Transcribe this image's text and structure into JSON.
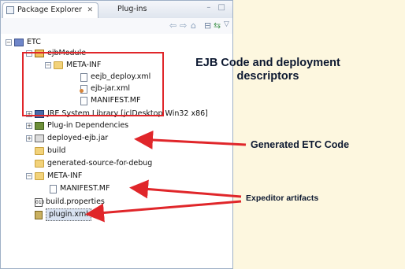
{
  "tabs": {
    "active": "Package Explorer",
    "active_close": "✕",
    "inactive": "Plug-ins"
  },
  "window_buttons": "– □",
  "toolbar": {
    "back": "⇦",
    "forward": "⇨",
    "home": "⌂",
    "collapse": "⊟",
    "link": "⇆",
    "menu": "▽"
  },
  "tree": {
    "root": "ETC",
    "ejbModule": "ejbModule",
    "meta_inf_1": "META-INF",
    "eejb_deploy": "eejb_deploy.xml",
    "ejb_jar": "ejb-jar.xml",
    "manifest_1": "MANIFEST.MF",
    "jre": "JRE System Library [jclDesktop Win32 x86]",
    "plugin_deps": "Plug-in Dependencies",
    "deployed_jar": "deployed-ejb.jar",
    "build": "build",
    "generated_source": "generated-source-for-debug",
    "meta_inf_2": "META-INF",
    "manifest_2": "MANIFEST.MF",
    "build_properties": "build.properties",
    "plugin_xml": "plugin.xml"
  },
  "annotations": {
    "ejb_line1": "EJB Code and deployment",
    "ejb_line2": "descriptors",
    "generated": "Generated ETC Code",
    "expeditor": "Expeditor artifacts"
  },
  "colors": {
    "arrow": "#e0262a",
    "highlight_box": "#e0262a",
    "background": "#fdf7df"
  }
}
